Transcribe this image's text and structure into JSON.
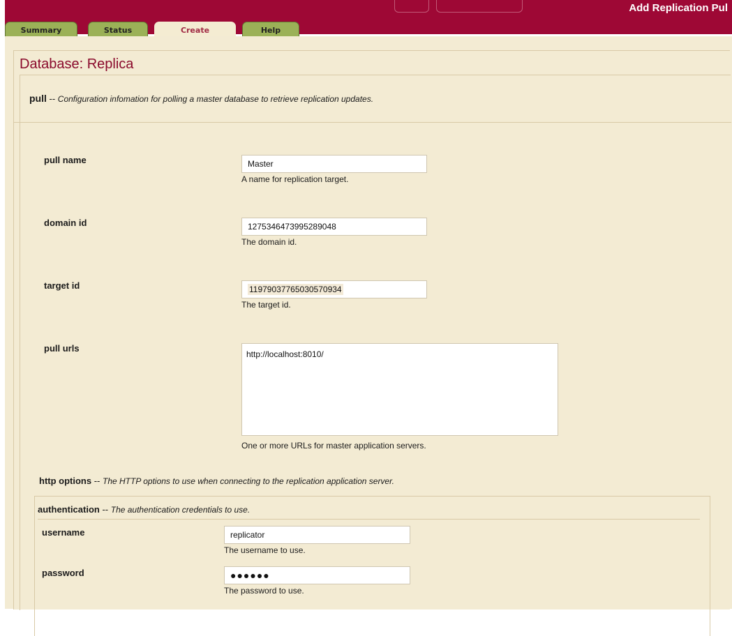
{
  "header": {
    "title": "Add Replication Pul",
    "background": "#9e0835"
  },
  "tabs": [
    {
      "label": "Summary"
    },
    {
      "label": "Status"
    },
    {
      "label": "Create"
    },
    {
      "label": "Help"
    }
  ],
  "page": {
    "database_title": "Database: Replica"
  },
  "pull": {
    "name": "pull",
    "separator": " -- ",
    "description": "Configuration infomation for polling a master database to retrieve replication updates."
  },
  "fields": {
    "pull_name": {
      "label": "pull name",
      "value": "Master",
      "help": "A name for replication target."
    },
    "domain_id": {
      "label": "domain id",
      "value": "1275346473995289048",
      "help": "The domain id."
    },
    "target_id": {
      "label": "target id",
      "value": "11979037765030570934",
      "help": "The target id."
    },
    "pull_urls": {
      "label": "pull urls",
      "value": "http://localhost:8010/",
      "help": "One or more URLs for master application servers."
    }
  },
  "http_options": {
    "name": "http options",
    "separator": " -- ",
    "description": "The HTTP options to use when connecting to the replication application server."
  },
  "authentication": {
    "name": "authentication",
    "separator": " -- ",
    "description": "The authentication credentials to use.",
    "username": {
      "label": "username",
      "value": "replicator",
      "help": "The username to use."
    },
    "password": {
      "label": "password",
      "value": "●●●●●●",
      "help": "The password to use."
    }
  }
}
